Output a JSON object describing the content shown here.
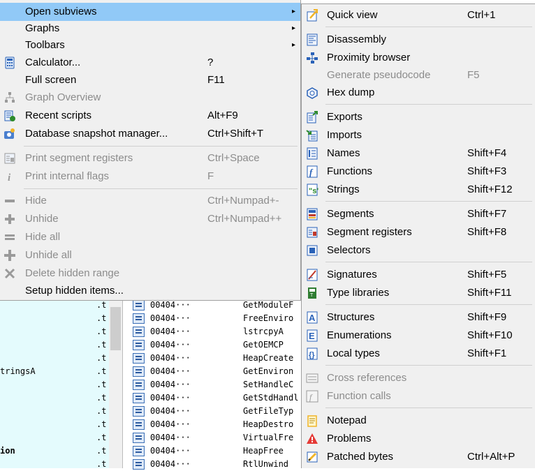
{
  "main_menu": [
    {
      "label": "Open subviews",
      "shortcut": "",
      "arrow": "▸",
      "icon": "none",
      "disabled": false,
      "highlighted": true
    },
    {
      "label": "Graphs",
      "shortcut": "",
      "arrow": "▸",
      "icon": "none",
      "disabled": false
    },
    {
      "label": "Toolbars",
      "shortcut": "",
      "arrow": "▸",
      "icon": "none",
      "disabled": false
    },
    {
      "label": "Calculator...",
      "shortcut": "?",
      "icon": "calculator-icon",
      "disabled": false
    },
    {
      "label": "Full screen",
      "shortcut": "F11",
      "icon": "none",
      "disabled": false
    },
    {
      "label": "Graph Overview",
      "shortcut": "",
      "icon": "graph-overview-icon",
      "disabled": true
    },
    {
      "label": "Recent scripts",
      "shortcut": "Alt+F9",
      "icon": "recent-scripts-icon",
      "disabled": false
    },
    {
      "label": "Database snapshot manager...",
      "shortcut": "Ctrl+Shift+T",
      "icon": "snapshot-icon",
      "disabled": false
    },
    {
      "label": "Print segment registers",
      "shortcut": "Ctrl+Space",
      "icon": "segment-registers-icon",
      "disabled": true
    },
    {
      "label": "Print internal flags",
      "shortcut": "F",
      "icon": "info-icon",
      "disabled": true
    },
    {
      "label": "Hide",
      "shortcut": "Ctrl+Numpad+-",
      "icon": "minus-icon",
      "disabled": true
    },
    {
      "label": "Unhide",
      "shortcut": "Ctrl+Numpad++",
      "icon": "plus-icon",
      "disabled": true
    },
    {
      "label": "Hide all",
      "shortcut": "",
      "icon": "minus-all-icon",
      "disabled": true
    },
    {
      "label": "Unhide all",
      "shortcut": "",
      "icon": "plus-all-icon",
      "disabled": true
    },
    {
      "label": "Delete hidden range",
      "shortcut": "",
      "icon": "delete-icon",
      "disabled": true
    },
    {
      "label": "Setup hidden items...",
      "shortcut": "",
      "icon": "none",
      "disabled": false
    }
  ],
  "sub_menu": [
    {
      "label": "Quick view",
      "shortcut": "Ctrl+1",
      "icon": "quick-view-icon",
      "disabled": false
    },
    {
      "label": "Disassembly",
      "shortcut": "",
      "icon": "disassembly-icon",
      "disabled": false
    },
    {
      "label": "Proximity browser",
      "shortcut": "",
      "icon": "proximity-icon",
      "disabled": false
    },
    {
      "label": "Generate pseudocode",
      "shortcut": "F5",
      "icon": "none",
      "disabled": true
    },
    {
      "label": "Hex dump",
      "shortcut": "",
      "icon": "hex-dump-icon",
      "disabled": false
    },
    {
      "label": "Exports",
      "shortcut": "",
      "icon": "exports-icon",
      "disabled": false
    },
    {
      "label": "Imports",
      "shortcut": "",
      "icon": "imports-icon",
      "disabled": false
    },
    {
      "label": "Names",
      "shortcut": "Shift+F4",
      "icon": "names-icon",
      "disabled": false
    },
    {
      "label": "Functions",
      "shortcut": "Shift+F3",
      "icon": "functions-icon",
      "disabled": false
    },
    {
      "label": "Strings",
      "shortcut": "Shift+F12",
      "icon": "strings-icon",
      "disabled": false
    },
    {
      "label": "Segments",
      "shortcut": "Shift+F7",
      "icon": "segments-icon",
      "disabled": false
    },
    {
      "label": "Segment registers",
      "shortcut": "Shift+F8",
      "icon": "segment-registers-icon",
      "disabled": false
    },
    {
      "label": "Selectors",
      "shortcut": "",
      "icon": "selectors-icon",
      "disabled": false
    },
    {
      "label": "Signatures",
      "shortcut": "Shift+F5",
      "icon": "signatures-icon",
      "disabled": false
    },
    {
      "label": "Type libraries",
      "shortcut": "Shift+F11",
      "icon": "type-libraries-icon",
      "disabled": false
    },
    {
      "label": "Structures",
      "shortcut": "Shift+F9",
      "icon": "structures-icon",
      "disabled": false
    },
    {
      "label": "Enumerations",
      "shortcut": "Shift+F10",
      "icon": "enumerations-icon",
      "disabled": false
    },
    {
      "label": "Local types",
      "shortcut": "Shift+F1",
      "icon": "local-types-icon",
      "disabled": false
    },
    {
      "label": "Cross references",
      "shortcut": "",
      "icon": "cross-references-icon",
      "disabled": true
    },
    {
      "label": "Function calls",
      "shortcut": "",
      "icon": "function-calls-icon",
      "disabled": true
    },
    {
      "label": "Notepad",
      "shortcut": "",
      "icon": "notepad-icon",
      "disabled": false
    },
    {
      "label": "Problems",
      "shortcut": "",
      "icon": "problems-icon",
      "disabled": false
    },
    {
      "label": "Patched bytes",
      "shortcut": "Ctrl+Alt+P",
      "icon": "patched-bytes-icon",
      "disabled": false
    }
  ],
  "background": {
    "left_rows": [
      {
        "name": "",
        "seg": ".t"
      },
      {
        "name": "",
        "seg": ".t"
      },
      {
        "name": "",
        "seg": ".t"
      },
      {
        "name": "",
        "seg": ".t"
      },
      {
        "name": "",
        "seg": ".t"
      },
      {
        "name": "tringsA",
        "seg": ".t"
      },
      {
        "name": "",
        "seg": ".t"
      },
      {
        "name": "",
        "seg": ".t"
      },
      {
        "name": "",
        "seg": ".t"
      },
      {
        "name": "",
        "seg": ".t"
      },
      {
        "name": "",
        "seg": ".t"
      },
      {
        "name": "ion",
        "seg": ".t"
      },
      {
        "name": "",
        "seg": ".t"
      }
    ],
    "right_rows": [
      {
        "addr": "00404···",
        "func": "GetModuleF"
      },
      {
        "addr": "00404···",
        "func": "FreeEnviro"
      },
      {
        "addr": "00404···",
        "func": "lstrcpyA"
      },
      {
        "addr": "00404···",
        "func": "GetOEMCP"
      },
      {
        "addr": "00404···",
        "func": "HeapCreate"
      },
      {
        "addr": "00404···",
        "func": "GetEnviron"
      },
      {
        "addr": "00404···",
        "func": "SetHandleC"
      },
      {
        "addr": "00404···",
        "func": "GetStdHandl"
      },
      {
        "addr": "00404···",
        "func": "GetFileTyp"
      },
      {
        "addr": "00404···",
        "func": "HeapDestro"
      },
      {
        "addr": "00404···",
        "func": "VirtualFre"
      },
      {
        "addr": "00404···",
        "func": "HeapFree"
      },
      {
        "addr": "00404···",
        "func": "RtlUnwind"
      }
    ]
  },
  "colors": {
    "menu_bg": "#f0f0f0",
    "highlight": "#91c9f7",
    "disabled_text": "#8c8c8c",
    "bg_left": "#e4fbfd"
  }
}
